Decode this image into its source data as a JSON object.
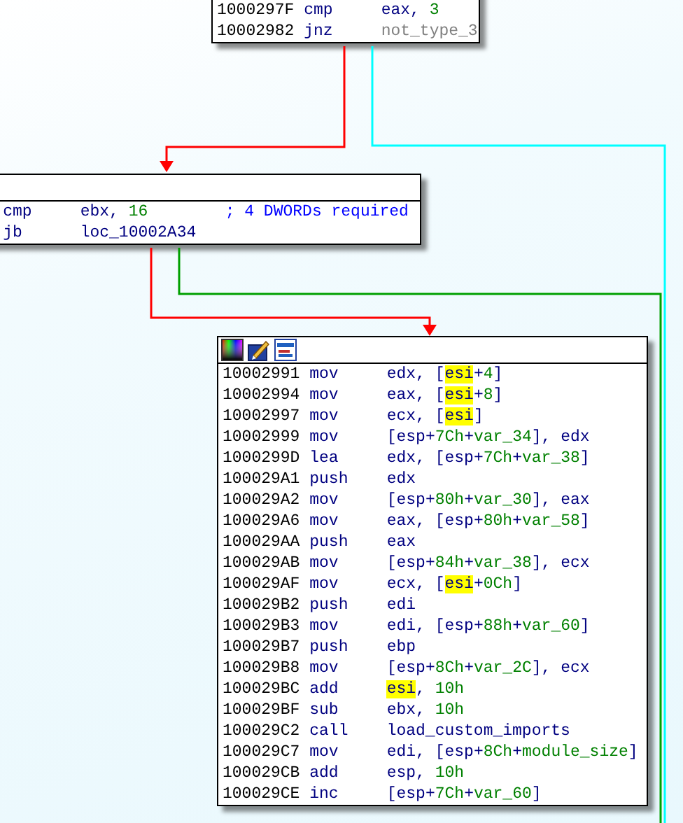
{
  "blocks": [
    {
      "lines": [
        {
          "address": "1000297F",
          "mnemonic": "cmp",
          "operand": [
            {
              "text": "eax",
              "kind": "reg"
            },
            {
              "text": ", ",
              "kind": "sym"
            },
            {
              "text": "3",
              "kind": "num"
            }
          ]
        },
        {
          "address": "10002982",
          "mnemonic": "jnz",
          "operand": [
            {
              "text": "not_type_3",
              "kind": "dim_ref"
            }
          ]
        }
      ]
    },
    {
      "lines": [
        {
          "mnemonic": "cmp",
          "operand": [
            {
              "text": "ebx",
              "kind": "reg"
            },
            {
              "text": ", ",
              "kind": "sym"
            },
            {
              "text": "16",
              "kind": "num"
            }
          ],
          "comment": "; 4 DWORDs required"
        },
        {
          "mnemonic": "jb",
          "operand": [
            {
              "text": "loc_10002A34",
              "kind": "ref"
            }
          ]
        }
      ]
    },
    {
      "toolbar": true,
      "lines": [
        {
          "address": "10002991",
          "mnemonic": "mov",
          "operand": [
            {
              "text": "edx",
              "kind": "reg"
            },
            {
              "text": ", [",
              "kind": "sym"
            },
            {
              "text": "esi",
              "kind": "hl"
            },
            {
              "text": "+",
              "kind": "sym"
            },
            {
              "text": "4",
              "kind": "num"
            },
            {
              "text": "]",
              "kind": "sym"
            }
          ]
        },
        {
          "address": "10002994",
          "mnemonic": "mov",
          "operand": [
            {
              "text": "eax",
              "kind": "reg"
            },
            {
              "text": ", [",
              "kind": "sym"
            },
            {
              "text": "esi",
              "kind": "hl"
            },
            {
              "text": "+",
              "kind": "sym"
            },
            {
              "text": "8",
              "kind": "num"
            },
            {
              "text": "]",
              "kind": "sym"
            }
          ]
        },
        {
          "address": "10002997",
          "mnemonic": "mov",
          "operand": [
            {
              "text": "ecx",
              "kind": "reg"
            },
            {
              "text": ", [",
              "kind": "sym"
            },
            {
              "text": "esi",
              "kind": "hl"
            },
            {
              "text": "]",
              "kind": "sym"
            }
          ]
        },
        {
          "address": "10002999",
          "mnemonic": "mov",
          "operand": [
            {
              "text": "[",
              "kind": "sym"
            },
            {
              "text": "esp",
              "kind": "reg"
            },
            {
              "text": "+",
              "kind": "sym"
            },
            {
              "text": "7Ch",
              "kind": "num"
            },
            {
              "text": "+",
              "kind": "sym"
            },
            {
              "text": "var_34",
              "kind": "var"
            },
            {
              "text": "], ",
              "kind": "sym"
            },
            {
              "text": "edx",
              "kind": "reg"
            }
          ]
        },
        {
          "address": "1000299D",
          "mnemonic": "lea",
          "operand": [
            {
              "text": "edx",
              "kind": "reg"
            },
            {
              "text": ", [",
              "kind": "sym"
            },
            {
              "text": "esp",
              "kind": "reg"
            },
            {
              "text": "+",
              "kind": "sym"
            },
            {
              "text": "7Ch",
              "kind": "num"
            },
            {
              "text": "+",
              "kind": "sym"
            },
            {
              "text": "var_38",
              "kind": "var"
            },
            {
              "text": "]",
              "kind": "sym"
            }
          ]
        },
        {
          "address": "100029A1",
          "mnemonic": "push",
          "operand": [
            {
              "text": "edx",
              "kind": "reg"
            }
          ]
        },
        {
          "address": "100029A2",
          "mnemonic": "mov",
          "operand": [
            {
              "text": "[",
              "kind": "sym"
            },
            {
              "text": "esp",
              "kind": "reg"
            },
            {
              "text": "+",
              "kind": "sym"
            },
            {
              "text": "80h",
              "kind": "num"
            },
            {
              "text": "+",
              "kind": "sym"
            },
            {
              "text": "var_30",
              "kind": "var"
            },
            {
              "text": "], ",
              "kind": "sym"
            },
            {
              "text": "eax",
              "kind": "reg"
            }
          ]
        },
        {
          "address": "100029A6",
          "mnemonic": "mov",
          "operand": [
            {
              "text": "eax",
              "kind": "reg"
            },
            {
              "text": ", [",
              "kind": "sym"
            },
            {
              "text": "esp",
              "kind": "reg"
            },
            {
              "text": "+",
              "kind": "sym"
            },
            {
              "text": "80h",
              "kind": "num"
            },
            {
              "text": "+",
              "kind": "sym"
            },
            {
              "text": "var_58",
              "kind": "var"
            },
            {
              "text": "]",
              "kind": "sym"
            }
          ]
        },
        {
          "address": "100029AA",
          "mnemonic": "push",
          "operand": [
            {
              "text": "eax",
              "kind": "reg"
            }
          ]
        },
        {
          "address": "100029AB",
          "mnemonic": "mov",
          "operand": [
            {
              "text": "[",
              "kind": "sym"
            },
            {
              "text": "esp",
              "kind": "reg"
            },
            {
              "text": "+",
              "kind": "sym"
            },
            {
              "text": "84h",
              "kind": "num"
            },
            {
              "text": "+",
              "kind": "sym"
            },
            {
              "text": "var_38",
              "kind": "var"
            },
            {
              "text": "], ",
              "kind": "sym"
            },
            {
              "text": "ecx",
              "kind": "reg"
            }
          ]
        },
        {
          "address": "100029AF",
          "mnemonic": "mov",
          "operand": [
            {
              "text": "ecx",
              "kind": "reg"
            },
            {
              "text": ", [",
              "kind": "sym"
            },
            {
              "text": "esi",
              "kind": "hl"
            },
            {
              "text": "+",
              "kind": "sym"
            },
            {
              "text": "0Ch",
              "kind": "num"
            },
            {
              "text": "]",
              "kind": "sym"
            }
          ]
        },
        {
          "address": "100029B2",
          "mnemonic": "push",
          "operand": [
            {
              "text": "edi",
              "kind": "reg"
            }
          ]
        },
        {
          "address": "100029B3",
          "mnemonic": "mov",
          "operand": [
            {
              "text": "edi",
              "kind": "reg"
            },
            {
              "text": ", [",
              "kind": "sym"
            },
            {
              "text": "esp",
              "kind": "reg"
            },
            {
              "text": "+",
              "kind": "sym"
            },
            {
              "text": "88h",
              "kind": "num"
            },
            {
              "text": "+",
              "kind": "sym"
            },
            {
              "text": "var_60",
              "kind": "var"
            },
            {
              "text": "]",
              "kind": "sym"
            }
          ]
        },
        {
          "address": "100029B7",
          "mnemonic": "push",
          "operand": [
            {
              "text": "ebp",
              "kind": "reg"
            }
          ]
        },
        {
          "address": "100029B8",
          "mnemonic": "mov",
          "operand": [
            {
              "text": "[",
              "kind": "sym"
            },
            {
              "text": "esp",
              "kind": "reg"
            },
            {
              "text": "+",
              "kind": "sym"
            },
            {
              "text": "8Ch",
              "kind": "num"
            },
            {
              "text": "+",
              "kind": "sym"
            },
            {
              "text": "var_2C",
              "kind": "var"
            },
            {
              "text": "], ",
              "kind": "sym"
            },
            {
              "text": "ecx",
              "kind": "reg"
            }
          ]
        },
        {
          "address": "100029BC",
          "mnemonic": "add",
          "operand": [
            {
              "text": "esi",
              "kind": "hl"
            },
            {
              "text": ", ",
              "kind": "sym"
            },
            {
              "text": "10h",
              "kind": "num"
            }
          ]
        },
        {
          "address": "100029BF",
          "mnemonic": "sub",
          "operand": [
            {
              "text": "ebx",
              "kind": "reg"
            },
            {
              "text": ", ",
              "kind": "sym"
            },
            {
              "text": "10h",
              "kind": "num"
            }
          ]
        },
        {
          "address": "100029C2",
          "mnemonic": "call",
          "operand": [
            {
              "text": "load_custom_imports",
              "kind": "ref"
            }
          ]
        },
        {
          "address": "100029C7",
          "mnemonic": "mov",
          "operand": [
            {
              "text": "edi",
              "kind": "reg"
            },
            {
              "text": ", [",
              "kind": "sym"
            },
            {
              "text": "esp",
              "kind": "reg"
            },
            {
              "text": "+",
              "kind": "sym"
            },
            {
              "text": "8Ch",
              "kind": "num"
            },
            {
              "text": "+",
              "kind": "sym"
            },
            {
              "text": "module_size",
              "kind": "var"
            },
            {
              "text": "]",
              "kind": "sym"
            }
          ]
        },
        {
          "address": "100029CB",
          "mnemonic": "add",
          "operand": [
            {
              "text": "esp",
              "kind": "reg"
            },
            {
              "text": ", ",
              "kind": "sym"
            },
            {
              "text": "10h",
              "kind": "num"
            }
          ]
        },
        {
          "address": "100029CE",
          "mnemonic": "inc",
          "operand": [
            {
              "text": "[",
              "kind": "sym"
            },
            {
              "text": "esp",
              "kind": "reg"
            },
            {
              "text": "+",
              "kind": "sym"
            },
            {
              "text": "7Ch",
              "kind": "num"
            },
            {
              "text": "+",
              "kind": "sym"
            },
            {
              "text": "var_60",
              "kind": "var"
            },
            {
              "text": "]",
              "kind": "sym"
            }
          ]
        }
      ]
    }
  ],
  "edges": [
    {
      "color": "#ff0000",
      "arrow": true
    },
    {
      "color": "#00ffff"
    },
    {
      "color": "#ff0000",
      "arrow": true
    },
    {
      "color": "#00a000"
    }
  ]
}
